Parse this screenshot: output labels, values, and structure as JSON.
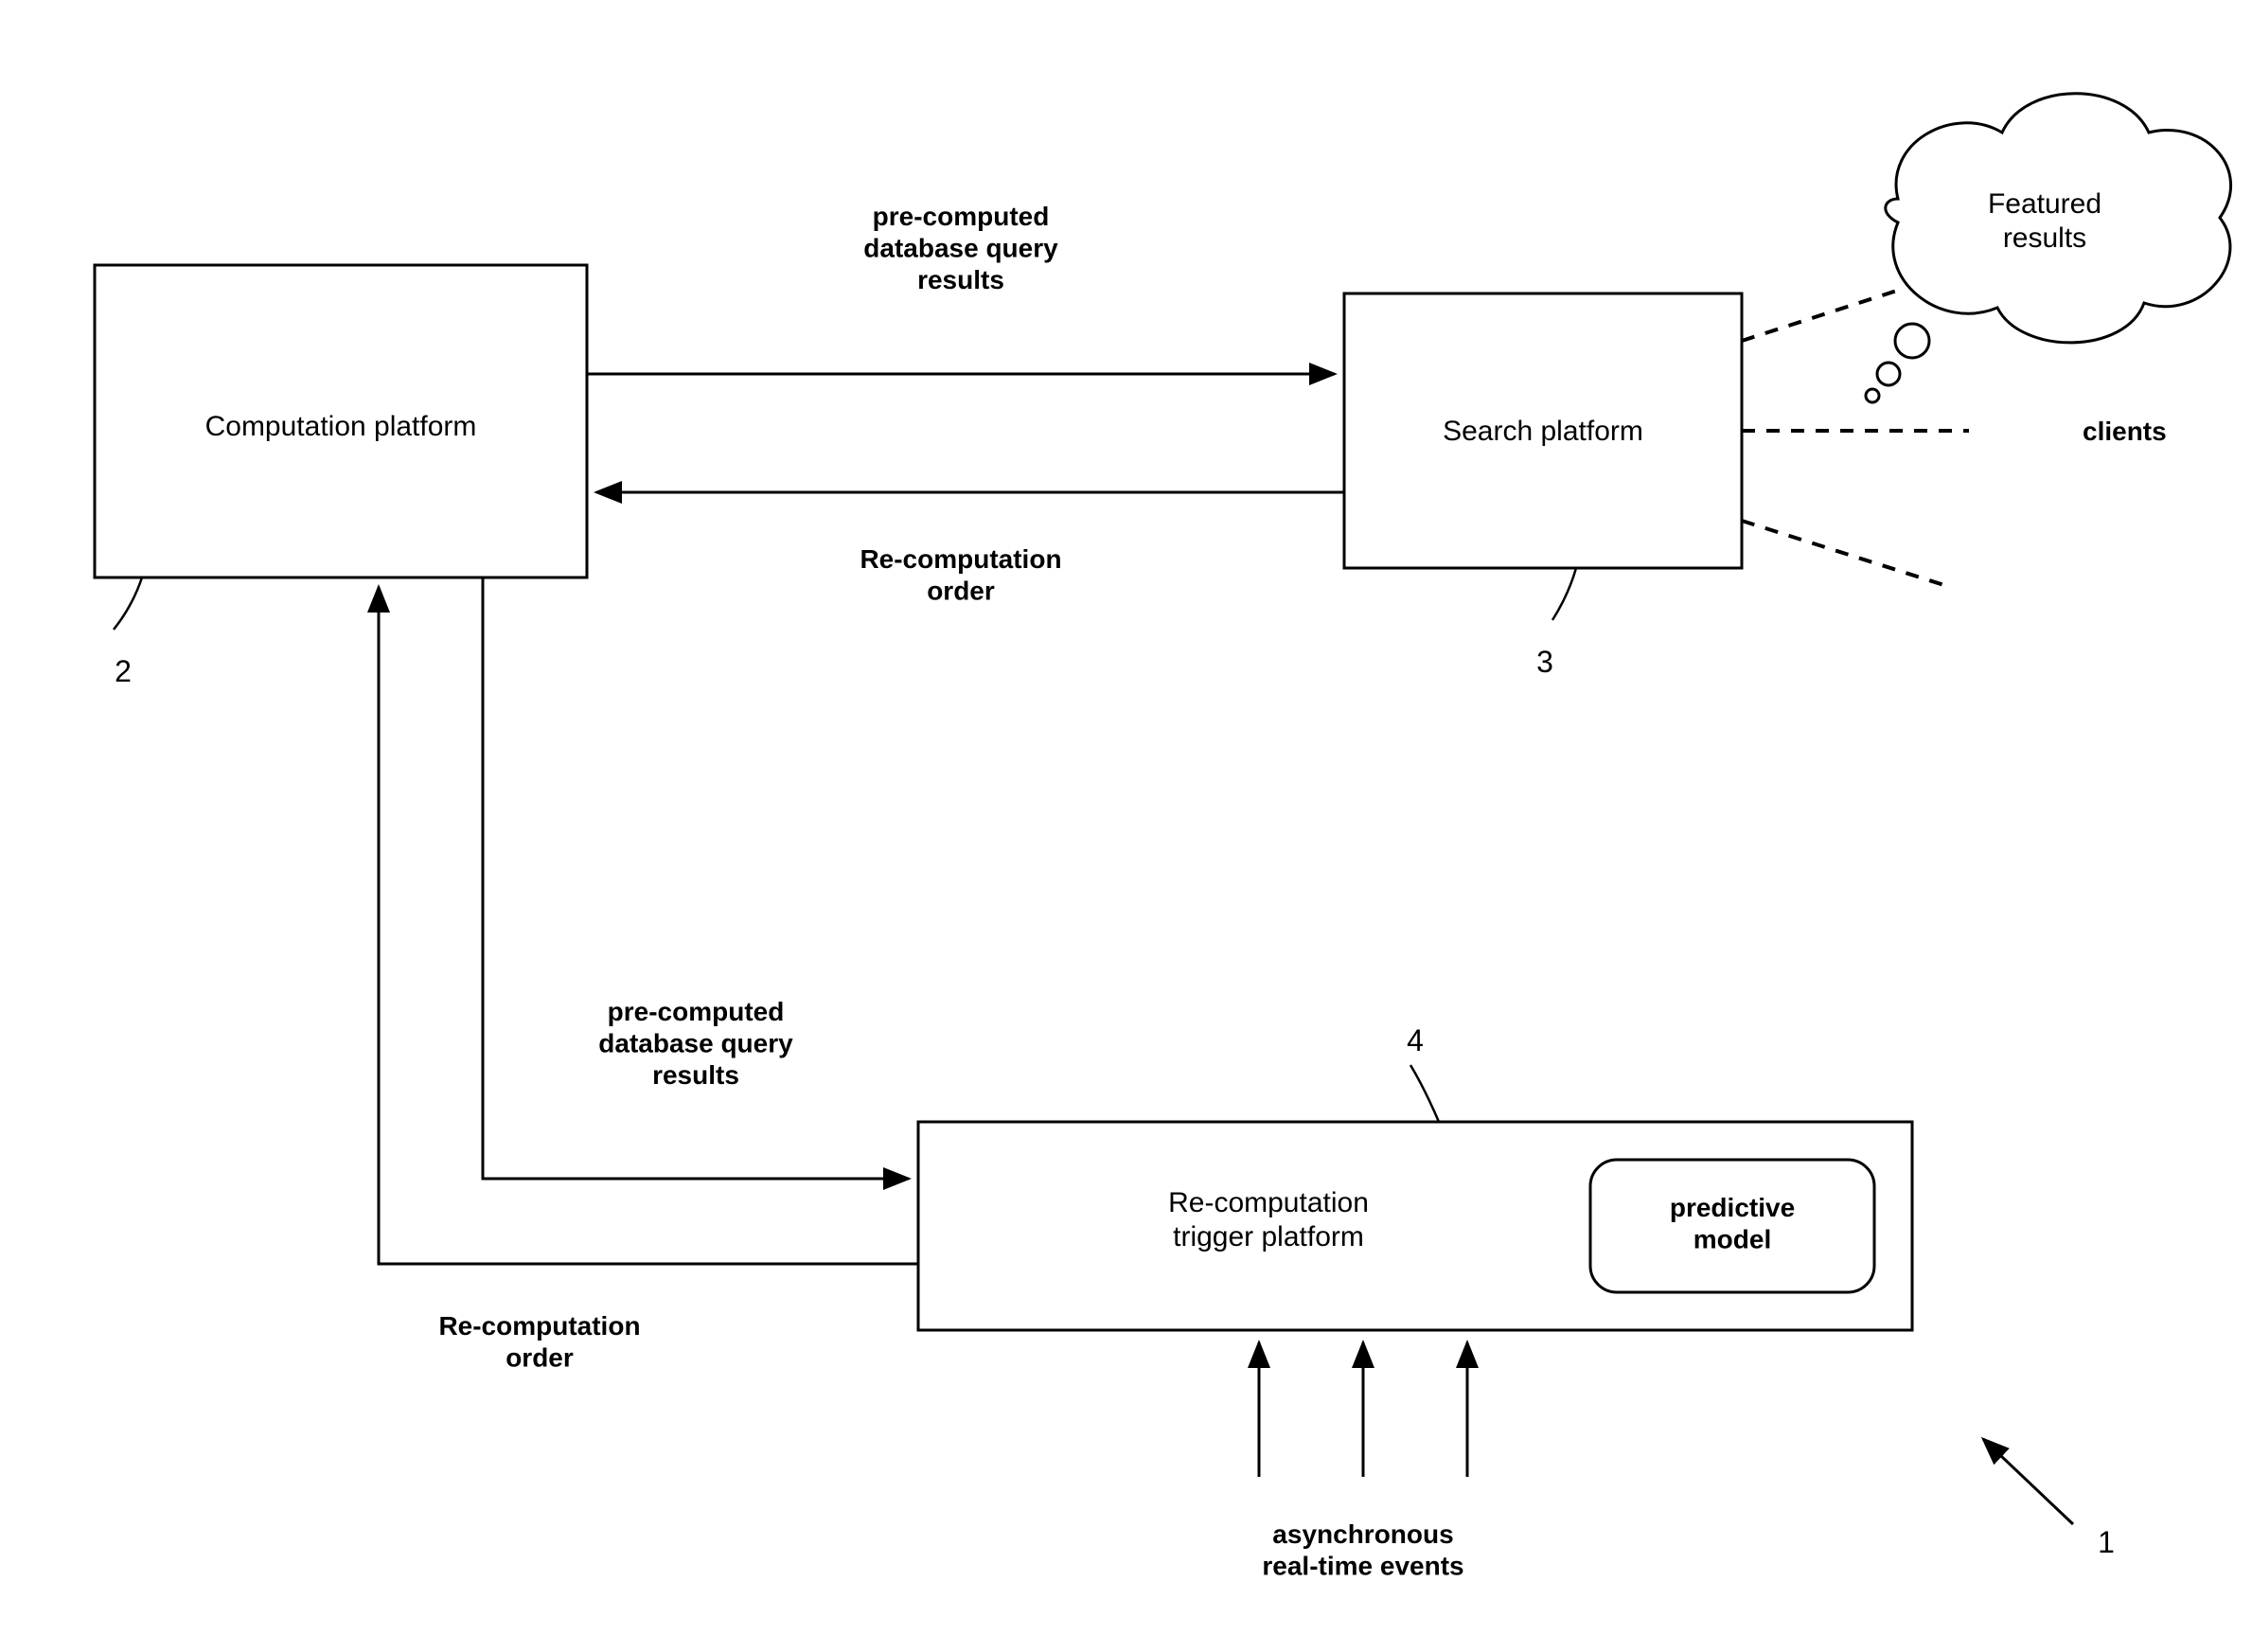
{
  "boxes": {
    "computation": "Computation platform",
    "search": "Search platform",
    "trigger": "Re-computation\ntrigger platform",
    "predictive": "predictive\nmodel"
  },
  "arrows": {
    "queryResultsTop": "pre-computed\ndatabase query\nresults",
    "recomputeTop": "Re-computation\norder",
    "queryResultsBottom": "pre-computed\ndatabase query\nresults",
    "recomputeBottom": "Re-computation\norder",
    "asyncEvents": "asynchronous\nreal-time events"
  },
  "right": {
    "featured": "Featured\nresults",
    "clients": "clients"
  },
  "refs": {
    "one": "1",
    "two": "2",
    "three": "3",
    "four": "4"
  }
}
